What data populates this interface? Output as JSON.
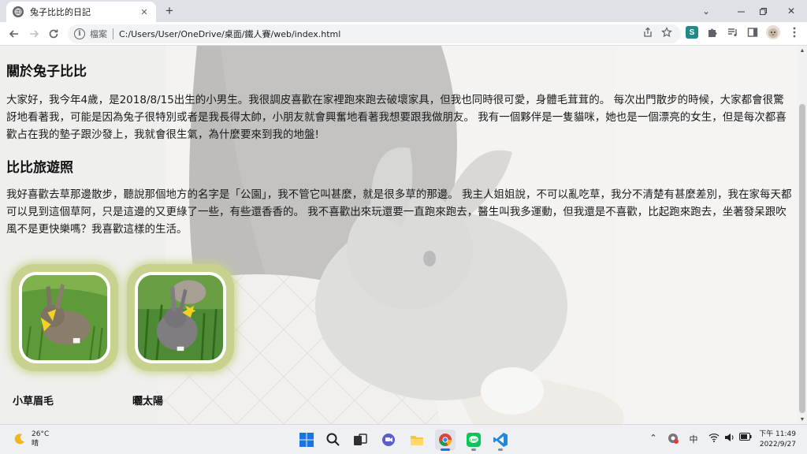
{
  "browser": {
    "tab_title": "兔子比比的日記",
    "new_tab_label": "+",
    "url_prefix": "檔案",
    "url": "C:/Users/User/OneDrive/桌面/鐵人賽/web/index.html",
    "window_controls": [
      "chevron-down-icon",
      "minimize-icon",
      "restore-icon",
      "close-icon"
    ],
    "extensions": [
      "s-extension-icon",
      "puzzle-icon",
      "reading-list-icon",
      "side-panel-icon",
      "profile-avatar",
      "kebab-menu-icon"
    ]
  },
  "page": {
    "about_heading": "關於兔子比比",
    "about_text": "大家好，我今年4歲，是2018/8/15出生的小男生。我很調皮喜歡在家裡跑來跑去破壞家具，但我也同時很可愛，身體毛茸茸的。 每次出門散步的時候，大家都會很驚訝地看著我，可能是因為兔子很特別或者是我長得太帥，小朋友就會興奮地看著我想要跟我做朋友。 我有一個夥伴是一隻貓咪，她也是一個漂亮的女生，但是每次都喜歡占在我的墊子跟沙發上，我就會很生氣，為什麼要來到我的地盤!",
    "travel_heading": "比比旅遊照",
    "travel_text": "我好喜歡去草那邊散步，聽說那個地方的名字是「公園」，我不管它叫甚麼，就是很多草的那邊。 我主人姐姐說，不可以亂吃草，我分不清楚有甚麼差別，我在家每天都可以見到這個草阿，只是這邊的又更綠了一些，有些還香香的。 我不喜歡出來玩還要一直跑來跑去，醫生叫我多運動，但我還是不喜歡，比起跑來跑去，坐著發呆跟吹風不是更快樂嗎？我喜歡這樣的生活。",
    "photos": [
      {
        "caption": "小草眉毛"
      },
      {
        "caption": "曬太陽"
      }
    ]
  },
  "taskbar": {
    "temperature": "26°C",
    "condition": "晴",
    "ime_label": "中",
    "time": "下午 11:49",
    "date": "2022/9/27",
    "apps": [
      "windows-start-icon",
      "search-icon",
      "task-view-icon",
      "chat-icon",
      "file-explorer-icon",
      "chrome-icon",
      "line-icon",
      "vscode-icon"
    ]
  },
  "colors": {
    "photo_frame": "#c8d28e",
    "heading_text": "#111111",
    "chrome_tabstrip": "#dee1e6"
  }
}
